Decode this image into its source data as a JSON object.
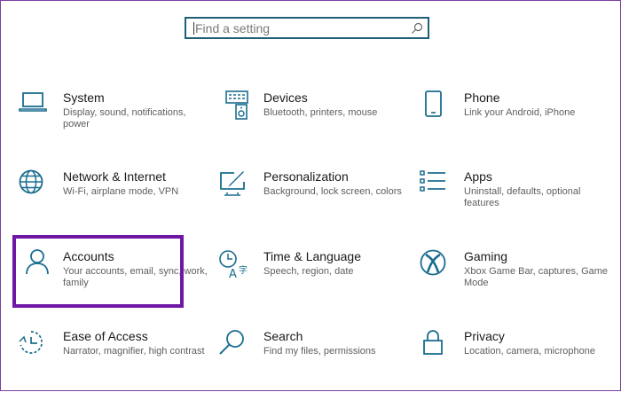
{
  "search": {
    "placeholder": "Find a setting"
  },
  "tiles": [
    {
      "title": "System",
      "desc": "Display, sound, notifications, power",
      "icon": "laptop-icon"
    },
    {
      "title": "Devices",
      "desc": "Bluetooth, printers, mouse",
      "icon": "devices-icon"
    },
    {
      "title": "Phone",
      "desc": "Link your Android, iPhone",
      "icon": "phone-icon"
    },
    {
      "title": "Network & Internet",
      "desc": "Wi-Fi, airplane mode, VPN",
      "icon": "globe-icon"
    },
    {
      "title": "Personalization",
      "desc": "Background, lock screen, colors",
      "icon": "personalization-icon"
    },
    {
      "title": "Apps",
      "desc": "Uninstall, defaults, optional features",
      "icon": "apps-list-icon"
    },
    {
      "title": "Accounts",
      "desc": "Your accounts, email, sync, work, family",
      "icon": "person-icon"
    },
    {
      "title": "Time & Language",
      "desc": "Speech, region, date",
      "icon": "time-language-icon"
    },
    {
      "title": "Gaming",
      "desc": "Xbox Game Bar, captures, Game Mode",
      "icon": "xbox-icon"
    },
    {
      "title": "Ease of Access",
      "desc": "Narrator, magnifier, high contrast",
      "icon": "ease-of-access-icon"
    },
    {
      "title": "Search",
      "desc": "Find my files, permissions",
      "icon": "search-icon"
    },
    {
      "title": "Privacy",
      "desc": "Location, camera, microphone",
      "icon": "lock-icon"
    }
  ],
  "colors": {
    "accent": "#1a6d8f",
    "highlight": "#6f17a6"
  }
}
